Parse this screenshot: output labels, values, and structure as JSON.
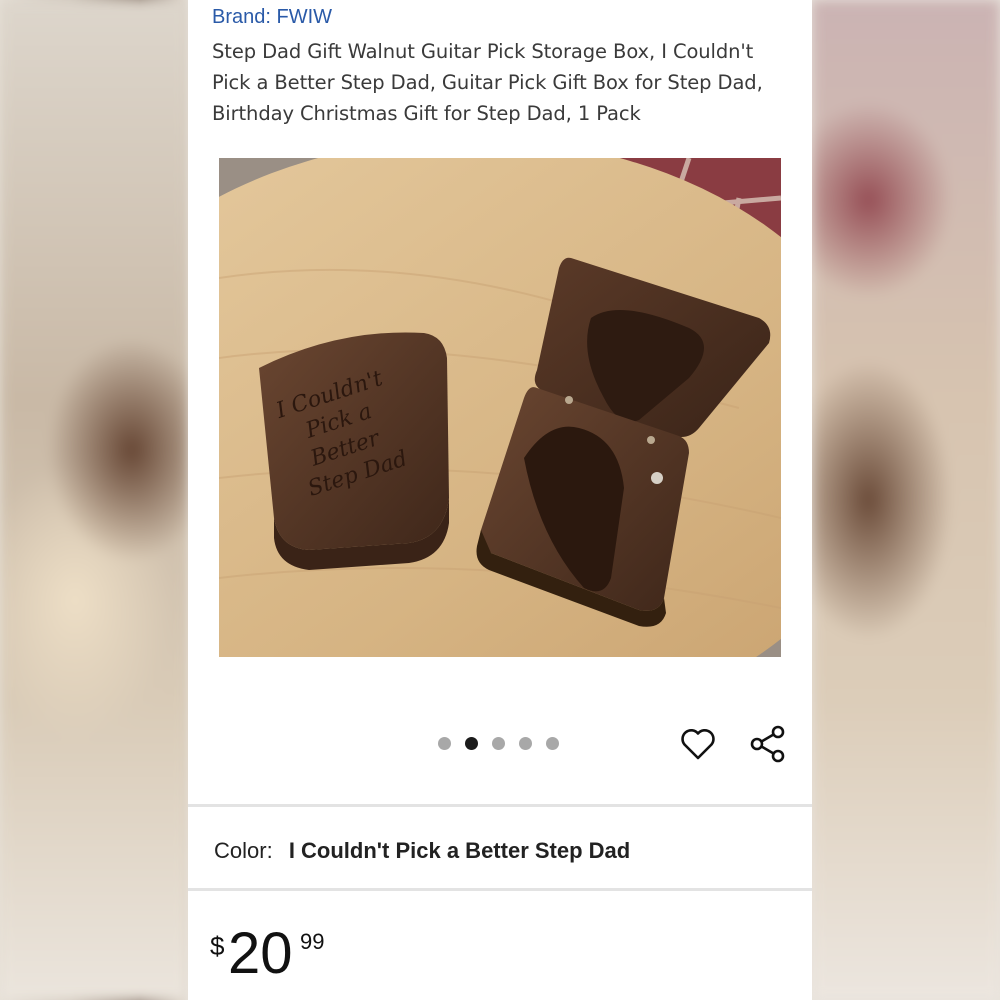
{
  "product": {
    "brand": "Brand: FWIW",
    "title": "Step Dad Gift Walnut Guitar Pick Storage Box, I Couldn't Pick a Better Step Dad, Guitar Pick Gift Box for Step Dad, Birthday Christmas Gift for Step Dad, 1 Pack",
    "engraving": [
      "I Couldn't",
      "Pick a",
      "Better",
      "Step Dad"
    ],
    "image_count": 5,
    "active_image_index": 1
  },
  "actions": {
    "favorite_icon": "heart-icon",
    "share_icon": "share-icon"
  },
  "variant": {
    "color_label": "Color:",
    "color_value": "I Couldn't Pick a Better Step Dad"
  },
  "price": {
    "currency": "$",
    "dollars": "20",
    "cents": "99"
  },
  "colors": {
    "brand_link": "#2a5aa8",
    "active_dot": "#1b1b1b",
    "inactive_dot": "#a8a8a8"
  }
}
